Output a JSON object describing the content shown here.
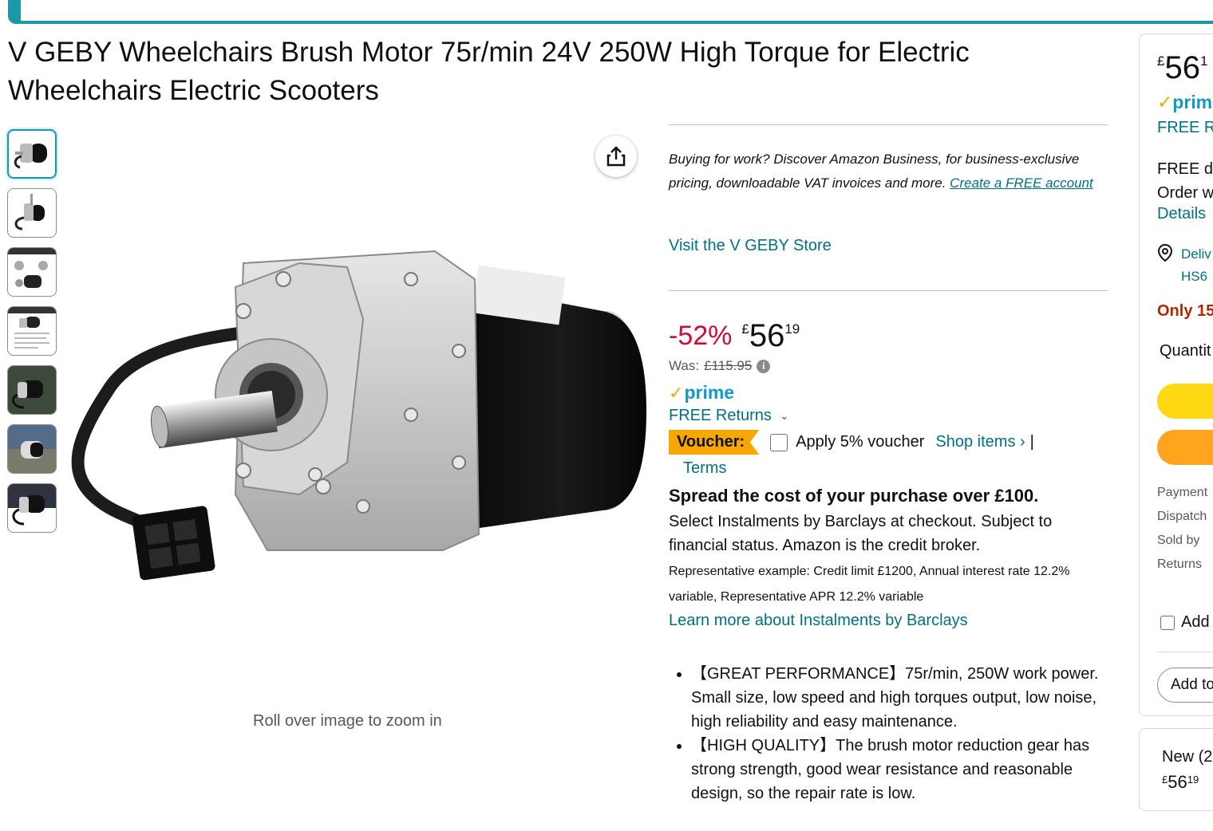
{
  "product": {
    "title_line1": "V GEBY Wheelchairs Brush Motor 75r/min 24V 250W High Torque for Electric",
    "title_line2": "Wheelchairs Electric Scooters",
    "zoom_hint": "Roll over image to zoom in",
    "thumbnail_count": 7,
    "share_icon": "share-icon"
  },
  "center": {
    "business_text": "Buying for work? Discover Amazon Business, for business-exclusive pricing, downloadable VAT invoices and more.",
    "business_link": "Create a FREE account",
    "store_link": "Visit the V GEBY Store",
    "discount": "-52%",
    "currency": "£",
    "price_whole": "56",
    "price_fraction": "19",
    "was_label": "Was:",
    "was_price": "£115.95",
    "prime_label": "prime",
    "free_returns": "FREE Returns",
    "voucher_label": "Voucher:",
    "voucher_apply": "Apply 5% voucher",
    "shop_items": "Shop items ›",
    "separator": "|",
    "terms": "Terms",
    "spread_heading": "Spread the cost of your purchase over £100.",
    "instalments_text": "Select Instalments by Barclays at checkout. Subject to financial status. Amazon is the credit broker.",
    "representative": "Representative example: Credit limit £1200, Annual interest rate 12.2% variable, Representative APR 12.2% variable",
    "learn_more": "Learn more about Instalments by Barclays",
    "bullets": [
      "【GREAT PERFORMANCE】75r/min, 250W work power. Small size, low speed and high torques output, low noise, high reliability and easy maintenance.",
      "【HIGH QUALITY】The brush motor reduction gear has strong strength, good wear resistance and reasonable design, so the repair rate is low."
    ]
  },
  "buybox": {
    "currency": "£",
    "price_whole": "56",
    "price_fraction": "1",
    "prime": "prime",
    "free_returns": "FREE Re",
    "free_delivery": "FREE de",
    "order_within": "Order w",
    "details": "Details",
    "deliver_to_1": "Deliv",
    "deliver_to_2": "HS6",
    "only_left": "Only 15",
    "quantity": "Quantit",
    "payment": "Payment",
    "dispatch": "Dispatch",
    "sold_by": "Sold by",
    "returns": "Returns",
    "add_gift": "Add",
    "add_to_list": "Add to",
    "accent_yellow": "#ffd814",
    "accent_orange": "#ffa41c"
  },
  "new_offers": {
    "label": "New (2",
    "currency": "£",
    "price_whole": "56",
    "price_fraction": "19"
  }
}
